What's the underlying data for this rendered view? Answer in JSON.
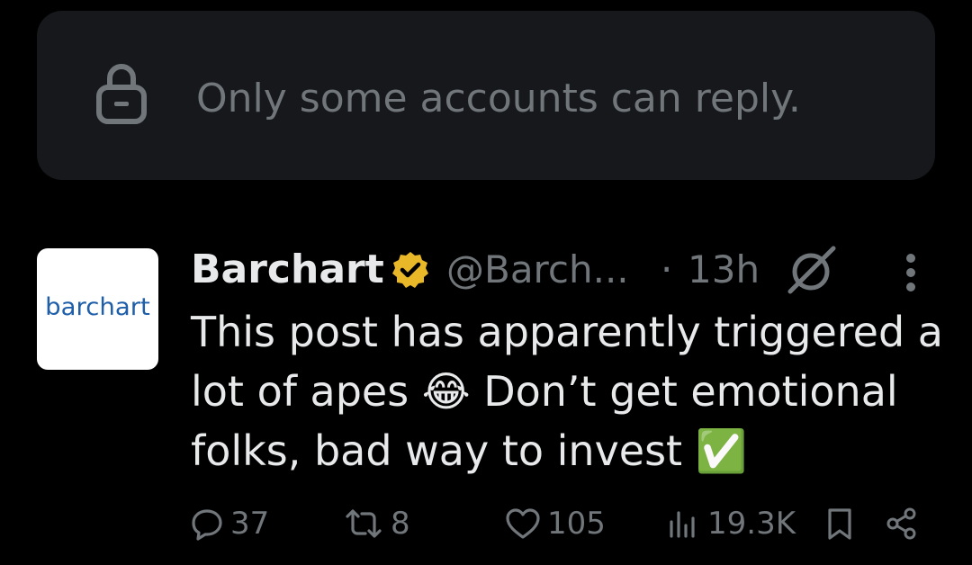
{
  "reply_banner": {
    "icon": "lock-icon",
    "text": "Only some accounts can reply."
  },
  "post": {
    "avatar": {
      "label": "barchart"
    },
    "author": {
      "name": "Barchart",
      "verified_icon": "verified-badge-icon",
      "handle": "@Barch...",
      "separator": "·",
      "time": "13h"
    },
    "text_lines": [
      "This post has apparently triggered a",
      "lot of apes 😂 Don’t get emotional",
      "folks, bad way to invest ✅"
    ],
    "actions": {
      "replies": "37",
      "reposts": "8",
      "likes": "105",
      "views": "19.3K"
    }
  },
  "colors": {
    "background": "#000000",
    "banner": "#16181c",
    "primary_text": "#e7e9ea",
    "secondary_text": "#71767b",
    "verified_gold": "#e8b829",
    "brand_blue": "#1f5ea8"
  }
}
